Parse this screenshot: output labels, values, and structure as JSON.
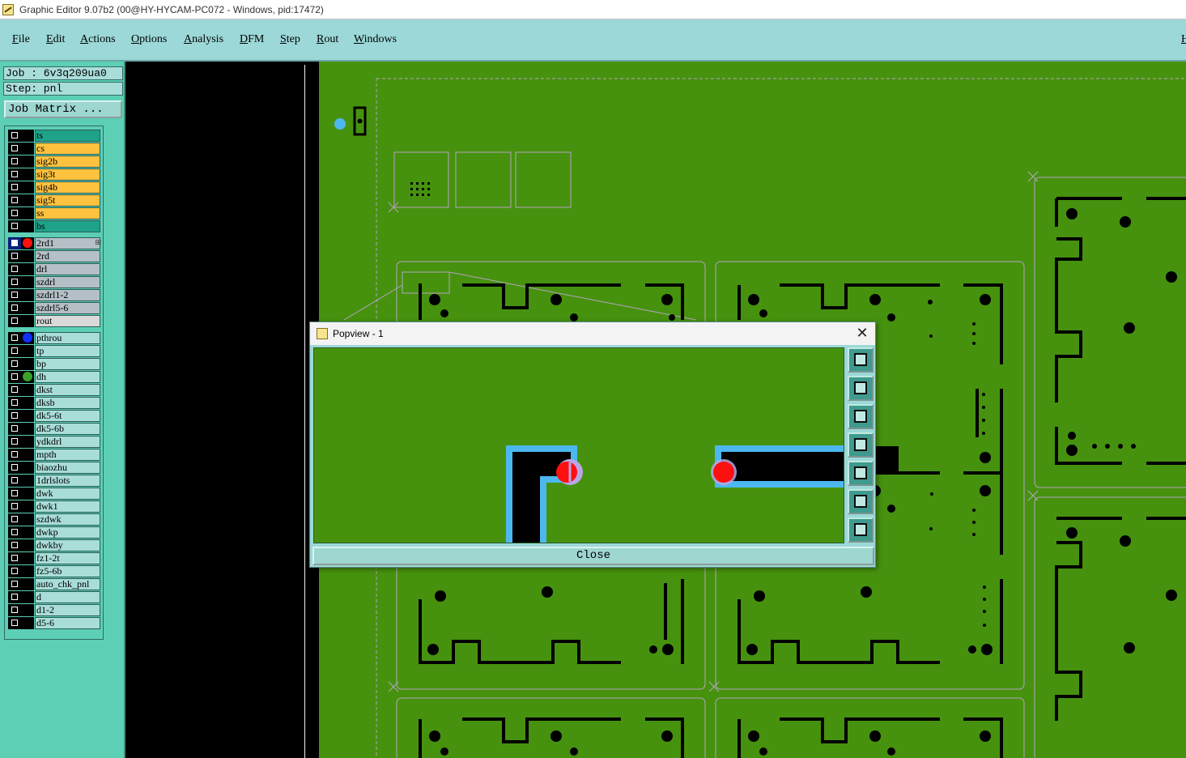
{
  "window": {
    "title": "Graphic Editor 9.07b2 (00@HY-HYCAM-PC072 - Windows, pid:17472)",
    "right_menu_fragment": "H"
  },
  "menu": [
    "File",
    "Edit",
    "Actions",
    "Options",
    "Analysis",
    "DFM",
    "Step",
    "Rout",
    "Windows"
  ],
  "info": {
    "job": "Job  :  6v3q209ua0",
    "step": "Step: pnl",
    "job_matrix": "Job Matrix ..."
  },
  "layers": [
    {
      "name": "ts",
      "color": "#1ea38a",
      "group": 1
    },
    {
      "name": "cs",
      "color": "#ffc23f",
      "group": 1
    },
    {
      "name": "sig2b",
      "color": "#ffc23f",
      "group": 1
    },
    {
      "name": "sig3t",
      "color": "#ffc23f",
      "group": 1
    },
    {
      "name": "sig4b",
      "color": "#ffc23f",
      "group": 1
    },
    {
      "name": "sig5t",
      "color": "#ffc23f",
      "group": 1
    },
    {
      "name": "ss",
      "color": "#ffc23f",
      "group": 1
    },
    {
      "name": "bs",
      "color": "#1ea38a",
      "group": 1
    },
    {
      "name": "2rd1",
      "color": "#b4bfc6",
      "group": 2,
      "dot": "#ff1010",
      "active": true,
      "mark": "⊞"
    },
    {
      "name": "2rd",
      "color": "#b4bfc6",
      "group": 2
    },
    {
      "name": "drl",
      "color": "#b4bfc6",
      "group": 2
    },
    {
      "name": "szdrl",
      "color": "#b4bfc6",
      "group": 2
    },
    {
      "name": "szdrl1-2",
      "color": "#b4bfc6",
      "group": 2
    },
    {
      "name": "szdrl5-6",
      "color": "#b4bfc6",
      "group": 2
    },
    {
      "name": "rout",
      "color": "#d9d9d9",
      "group": 2
    },
    {
      "name": "pthrou",
      "color": "#a9ddd8",
      "group": 3,
      "dot": "#1030ff"
    },
    {
      "name": "tp",
      "color": "#a9ddd8",
      "group": 3
    },
    {
      "name": "bp",
      "color": "#a9ddd8",
      "group": 3
    },
    {
      "name": "dh",
      "color": "#a9ddd8",
      "group": 3,
      "dot": "#3aa02a"
    },
    {
      "name": "dkst",
      "color": "#a9ddd8",
      "group": 3
    },
    {
      "name": "dksb",
      "color": "#a9ddd8",
      "group": 3
    },
    {
      "name": "dk5-6t",
      "color": "#a9ddd8",
      "group": 3
    },
    {
      "name": "dk5-6b",
      "color": "#a9ddd8",
      "group": 3
    },
    {
      "name": "ydkdrl",
      "color": "#a9ddd8",
      "group": 3
    },
    {
      "name": "mpth",
      "color": "#a9ddd8",
      "group": 3
    },
    {
      "name": "biaozhu",
      "color": "#a9ddd8",
      "group": 3
    },
    {
      "name": "1drlslots",
      "color": "#a9ddd8",
      "group": 3
    },
    {
      "name": "dwk",
      "color": "#a9ddd8",
      "group": 3
    },
    {
      "name": "dwk1",
      "color": "#a9ddd8",
      "group": 3
    },
    {
      "name": "szdwk",
      "color": "#a9ddd8",
      "group": 3
    },
    {
      "name": "dwkp",
      "color": "#a9ddd8",
      "group": 3
    },
    {
      "name": "dwkby",
      "color": "#a9ddd8",
      "group": 3
    },
    {
      "name": "fz1-2t",
      "color": "#a9ddd8",
      "group": 3
    },
    {
      "name": "fz5-6b",
      "color": "#a9ddd8",
      "group": 3
    },
    {
      "name": "auto_chk_pnl",
      "color": "#a9ddd8",
      "group": 3
    },
    {
      "name": "d",
      "color": "#a9ddd8",
      "group": 3
    },
    {
      "name": "d1-2",
      "color": "#a9ddd8",
      "group": 3
    },
    {
      "name": "d5-6",
      "color": "#a9ddd8",
      "group": 3
    }
  ],
  "popview": {
    "title": "Popview - 1",
    "close_label": "Close",
    "tools": [
      "zoom-window-icon",
      "pan-up-icon",
      "pan-down-icon",
      "pan-left-icon",
      "pan-right-icon",
      "zoom-out-icon",
      "zoom-in-icon"
    ]
  },
  "colors": {
    "canvas_bg": "#46920e",
    "panel_bg": "#5ccfb5",
    "menu_bg": "#9cd8d8",
    "highlight": "#4db8f0",
    "marker": "#ff1010"
  }
}
